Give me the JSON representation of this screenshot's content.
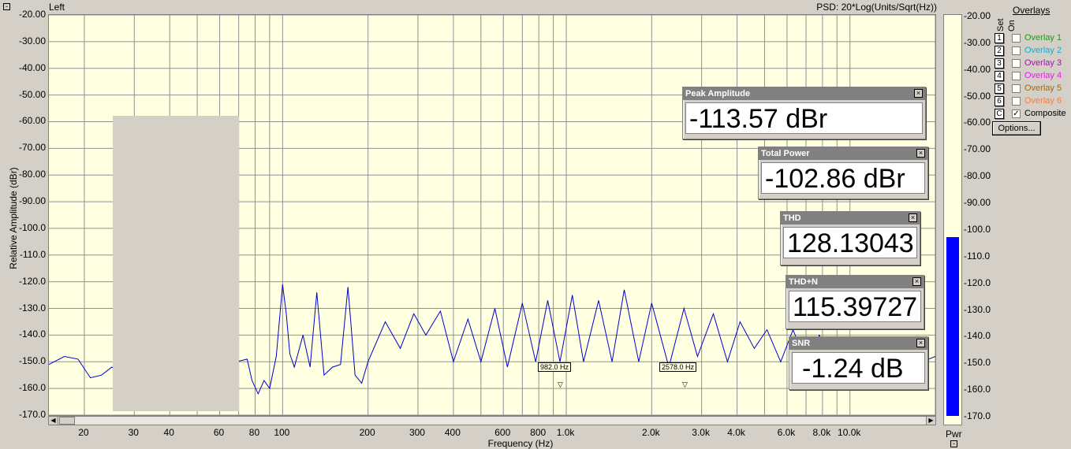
{
  "header": {
    "left_title": "Left",
    "right_title": "PSD: 20*Log(Units/Sqrt(Hz))"
  },
  "chart_data": {
    "type": "line",
    "title": "",
    "xlabel": "Frequency (Hz)",
    "ylabel": "Relative Amplitude (dBr)",
    "xscale": "log",
    "xlim": [
      15,
      20000
    ],
    "ylim": [
      -170,
      -20
    ],
    "yticks": [
      "-20.00",
      "-30.00",
      "-40.00",
      "-50.00",
      "-60.00",
      "-70.00",
      "-80.00",
      "-90.00",
      "-100.0",
      "-110.0",
      "-120.0",
      "-130.0",
      "-140.0",
      "-150.0",
      "-160.0",
      "-170.0"
    ],
    "xticks": [
      "20",
      "30",
      "40",
      "60",
      "80",
      "100",
      "200",
      "300",
      "400",
      "600",
      "800",
      "1.0k",
      "2.0k",
      "3.0k",
      "4.0k",
      "6.0k",
      "8.0k",
      "10.0k"
    ],
    "xtick_values": [
      20,
      30,
      40,
      60,
      80,
      100,
      200,
      300,
      400,
      600,
      800,
      1000,
      2000,
      3000,
      4000,
      6000,
      8000,
      10000
    ],
    "grid": true,
    "series": [
      {
        "color": "#0000cc",
        "x": [
          15,
          17,
          19,
          21,
          23,
          25,
          27,
          29,
          75,
          78,
          82,
          86,
          90,
          95,
          100,
          103,
          106,
          110,
          118,
          125,
          132,
          140,
          150,
          160,
          170,
          180,
          190,
          200,
          230,
          260,
          290,
          320,
          360,
          400,
          450,
          500,
          560,
          620,
          700,
          780,
          860,
          950,
          1050,
          1150,
          1300,
          1450,
          1600,
          1800,
          2000,
          2300,
          2600,
          2900,
          3300,
          3700,
          4100,
          4600,
          5100,
          5700,
          6300,
          7000,
          7800,
          8700,
          9700,
          11000,
          12500,
          14000,
          16000,
          18000,
          20000
        ],
        "y": [
          -151,
          -148,
          -149,
          -156,
          -155,
          -152,
          -154,
          -160,
          -149,
          -157,
          -162,
          -157,
          -160,
          -148,
          -121,
          -132,
          -147,
          -152,
          -140,
          -152,
          -124,
          -155,
          -152,
          -151,
          -122,
          -155,
          -158,
          -150,
          -135,
          -145,
          -132,
          -140,
          -131,
          -150,
          -134,
          -150,
          -130,
          -152,
          -128,
          -150,
          -127,
          -150,
          -125,
          -150,
          -127,
          -150,
          -123,
          -150,
          -128,
          -152,
          -130,
          -148,
          -132,
          -150,
          -135,
          -145,
          -138,
          -150,
          -138,
          -150,
          -140,
          -152,
          -145,
          -150,
          -145,
          -148,
          -147,
          -150,
          -148
        ]
      }
    ]
  },
  "meter_scale": {
    "ticks": [
      "-20.00",
      "-30.00",
      "-40.00",
      "-50.00",
      "-60.00",
      "-70.00",
      "-80.00",
      "-90.00",
      "-100.0",
      "-110.0",
      "-120.0",
      "-130.0",
      "-140.0",
      "-150.0",
      "-160.0",
      "-170.0"
    ],
    "level": -102.86,
    "label": "Pwr",
    "color": "#0000ff"
  },
  "overlays": {
    "header": "Overlays",
    "set_label": "Set",
    "on_label": "On",
    "items": [
      {
        "num": "1",
        "label": "Overlay 1",
        "color": "#1c9a1c",
        "checked": ""
      },
      {
        "num": "2",
        "label": "Overlay 2",
        "color": "#1caac8",
        "checked": ""
      },
      {
        "num": "3",
        "label": "Overlay 3",
        "color": "#9a1c9a",
        "checked": ""
      },
      {
        "num": "4",
        "label": "Overlay 4",
        "color": "#e020e0",
        "checked": ""
      },
      {
        "num": "5",
        "label": "Overlay 5",
        "color": "#9a6a1c",
        "checked": ""
      },
      {
        "num": "6",
        "label": "Overlay 6",
        "color": "#f08040",
        "checked": ""
      },
      {
        "num": "C",
        "label": "Composite",
        "color": "#000000",
        "checked": "✓"
      }
    ],
    "options_label": "Options..."
  },
  "meters": {
    "peak": {
      "title": "Peak Amplitude",
      "value": "-113.57 dBr"
    },
    "total": {
      "title": "Total Power",
      "value": "-102.86 dBr"
    },
    "thd": {
      "title": "THD",
      "value": "128.13043"
    },
    "thdn": {
      "title": "THD+N",
      "value": "115.39727"
    },
    "snr": {
      "title": "SNR",
      "value": "-1.24 dB"
    }
  },
  "cursors": {
    "c1": "982.0 Hz",
    "c2": "2578.0 Hz"
  }
}
